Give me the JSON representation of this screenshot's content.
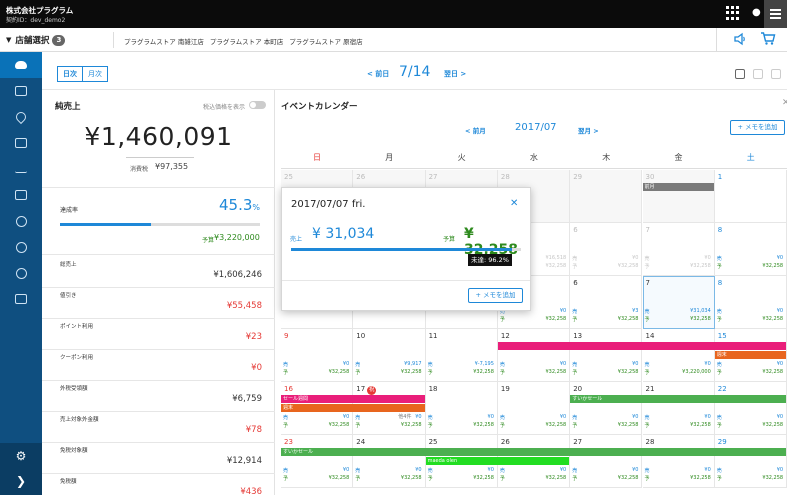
{
  "header": {
    "company": "株式会社プラグラム",
    "contract_id": "契約ID：dev_demo2",
    "icons": [
      "grid-icon",
      "bell-icon",
      "menu-icon"
    ]
  },
  "store_bar": {
    "toggle_label": "店舗選択",
    "count": "3",
    "stores": [
      "プラグラムストア 南雑江店",
      "プラグラムストア 本町店",
      "プラグラムストア 原宿店"
    ],
    "icons": [
      "speaker-icon",
      "cart-icon"
    ]
  },
  "nav": {
    "items": [
      {
        "name": "weather-icon",
        "active": true
      },
      {
        "name": "box-icon"
      },
      {
        "name": "wrench-icon"
      },
      {
        "name": "table-icon"
      },
      {
        "name": "line-chart-icon"
      },
      {
        "name": "shop-icon"
      },
      {
        "name": "yen-icon"
      },
      {
        "name": "target-icon"
      },
      {
        "name": "yen-coin-icon"
      },
      {
        "name": "layout-icon"
      }
    ],
    "bottom": [
      "gear-icon",
      "chevron-right-icon"
    ]
  },
  "view_bar": {
    "tabs": [
      {
        "label": "日次",
        "active": true
      },
      {
        "label": "月次",
        "active": false
      }
    ],
    "prev_label": "< 前日",
    "current_date": "7/14",
    "next_label": "翌日 >",
    "layout_icons": [
      "single-pane-icon",
      "split-pane-icon",
      "triple-pane-icon"
    ]
  },
  "sales": {
    "title": "純売上",
    "tax_toggle_label": "税込価格を表示",
    "total": "¥1,460,091",
    "tax_label": "消費税",
    "tax_value": "¥97,355",
    "achievement_label": "達成率",
    "achievement_value": "45.3",
    "achievement_unit": "%",
    "achievement_ratio": 0.453,
    "budget_label": "予算",
    "budget_value": "¥3,220,000",
    "metrics": [
      {
        "label": "総売上",
        "value": "¥1,606,246",
        "color": "#333333"
      },
      {
        "label": "値引き",
        "value": "¥55,458",
        "color": "#e53935"
      },
      {
        "label": "ポイント利用",
        "value": "¥23",
        "color": "#e53935"
      },
      {
        "label": "クーポン利用",
        "value": "¥0",
        "color": "#e53935"
      },
      {
        "label": "外税受領額",
        "value": "¥6,759",
        "color": "#333333"
      },
      {
        "label": "売上対象外金額",
        "value": "¥78",
        "color": "#e53935"
      },
      {
        "label": "免税対象額",
        "value": "¥12,914",
        "color": "#333333"
      },
      {
        "label": "免税額",
        "value": "¥436",
        "color": "#e53935"
      }
    ]
  },
  "calendar": {
    "title": "イベントカレンダー",
    "add_memo": "+ メモを追加",
    "prev_label": "< 前月",
    "month": "2017/07",
    "next_label": "翌月 >",
    "weekdays": [
      "日",
      "月",
      "火",
      "水",
      "木",
      "金",
      "土"
    ],
    "actual_prefix": "売",
    "budget_prefix": "予",
    "weeks": [
      [
        {
          "day": "25",
          "muted": true
        },
        {
          "day": "26",
          "muted": true
        },
        {
          "day": "27",
          "muted": true
        },
        {
          "day": "28",
          "muted": true
        },
        {
          "day": "29",
          "muted": true
        },
        {
          "day": "30",
          "muted": true
        },
        {
          "day": "1"
        }
      ],
      [
        {
          "day": "2"
        },
        {
          "day": "3"
        },
        {
          "day": "4"
        },
        {
          "day": "5",
          "act": "¥16,518",
          "bud": "¥32,258",
          "muted": true
        },
        {
          "day": "6",
          "act": "¥0",
          "bud": "¥32,258",
          "muted": true
        },
        {
          "day": "7",
          "act": "¥0",
          "bud": "¥32,258",
          "muted": true
        },
        {
          "day": "8",
          "act": "¥0",
          "bud": "¥32,258"
        }
      ],
      [
        {
          "day": "9"
        },
        {
          "day": "10"
        },
        {
          "day": "11"
        },
        {
          "day": "12",
          "act": "¥0",
          "bud": "¥32,258"
        },
        {
          "day": "6",
          "act": "¥3",
          "bud": "¥32,258"
        },
        {
          "day": "7",
          "act": "¥31,034",
          "bud": "¥32,258",
          "today": true
        },
        {
          "day": "8",
          "act": "¥0",
          "bud": "¥32,258"
        }
      ],
      [
        {
          "day": "9",
          "act": "¥0",
          "bud": "¥32,258"
        },
        {
          "day": "10",
          "act": "¥9,917",
          "bud": "¥32,258"
        },
        {
          "day": "11",
          "act": "¥-7,195",
          "bud": "¥32,258"
        },
        {
          "day": "12",
          "act": "¥0",
          "bud": "¥32,258"
        },
        {
          "day": "13",
          "act": "¥0",
          "bud": "¥32,258"
        },
        {
          "day": "14",
          "act": "¥0",
          "bud": "¥3,220,000"
        },
        {
          "day": "15",
          "act": "¥0",
          "bud": "¥32,258"
        }
      ],
      [
        {
          "day": "16",
          "act": "¥0",
          "bud": "¥32,258"
        },
        {
          "day": "17",
          "holiday": "祝",
          "act": "¥0",
          "bud": "¥32,258"
        },
        {
          "day": "18",
          "act": "¥0",
          "bud": "¥32,258"
        },
        {
          "day": "19",
          "act": "¥0",
          "bud": "¥32,258"
        },
        {
          "day": "20",
          "act": "¥0",
          "bud": "¥32,258"
        },
        {
          "day": "21",
          "act": "¥0",
          "bud": "¥32,258"
        },
        {
          "day": "22",
          "act": "¥0",
          "bud": "¥32,258"
        }
      ],
      [
        {
          "day": "23",
          "act": "¥0",
          "bud": "¥32,258"
        },
        {
          "day": "24",
          "act": "¥0",
          "bud": "¥32,258"
        },
        {
          "day": "25",
          "act": "¥0",
          "bud": "¥32,258"
        },
        {
          "day": "26",
          "act": "¥0",
          "bud": "¥32,258"
        },
        {
          "day": "27",
          "act": "¥0",
          "bud": "¥32,258"
        },
        {
          "day": "28",
          "act": "¥0",
          "bud": "¥32,258"
        },
        {
          "day": "29",
          "act": "¥0",
          "bud": "¥32,258"
        }
      ]
    ],
    "events": [
      {
        "label": "前月",
        "week": 0,
        "start": 5,
        "span": 1,
        "lane": 0,
        "color": "#7a7a7a"
      },
      {
        "label": "",
        "week": 3,
        "start": 3,
        "span": 4,
        "lane": 0,
        "color": "#e91e7a"
      },
      {
        "label": "週末",
        "week": 3,
        "start": 6,
        "span": 1,
        "lane": 1,
        "color": "#e8651e"
      },
      {
        "label": "セール週間",
        "week": 4,
        "start": 0,
        "span": 2,
        "lane": 0,
        "color": "#e91e7a"
      },
      {
        "label": "週末",
        "week": 4,
        "start": 0,
        "span": 2,
        "lane": 1,
        "color": "#e8651e"
      },
      {
        "label": "すいかセール",
        "week": 4,
        "start": 4,
        "span": 3,
        "lane": 0,
        "color": "#4caf50"
      },
      {
        "label": "すいかセール",
        "week": 5,
        "start": 0,
        "span": 7,
        "lane": 0,
        "color": "#4caf50"
      },
      {
        "label": "maeda olen",
        "week": 5,
        "start": 2,
        "span": 2,
        "lane": 1,
        "color": "#22dd22"
      }
    ],
    "more_label": "他4件"
  },
  "popup": {
    "date": "2017/07/07 fri.",
    "actual_label": "売上",
    "actual_value": "¥ 31,034",
    "budget_label": "予算",
    "budget_value": "¥ 32,258",
    "ratio": 0.962,
    "badge": "未達: 96.2%",
    "add_memo": "+ メモを追加"
  },
  "colors": {
    "accent": "#1e88d8",
    "budget": "#2e8a1e",
    "negative": "#e53935",
    "nav": "#0f4f80"
  }
}
